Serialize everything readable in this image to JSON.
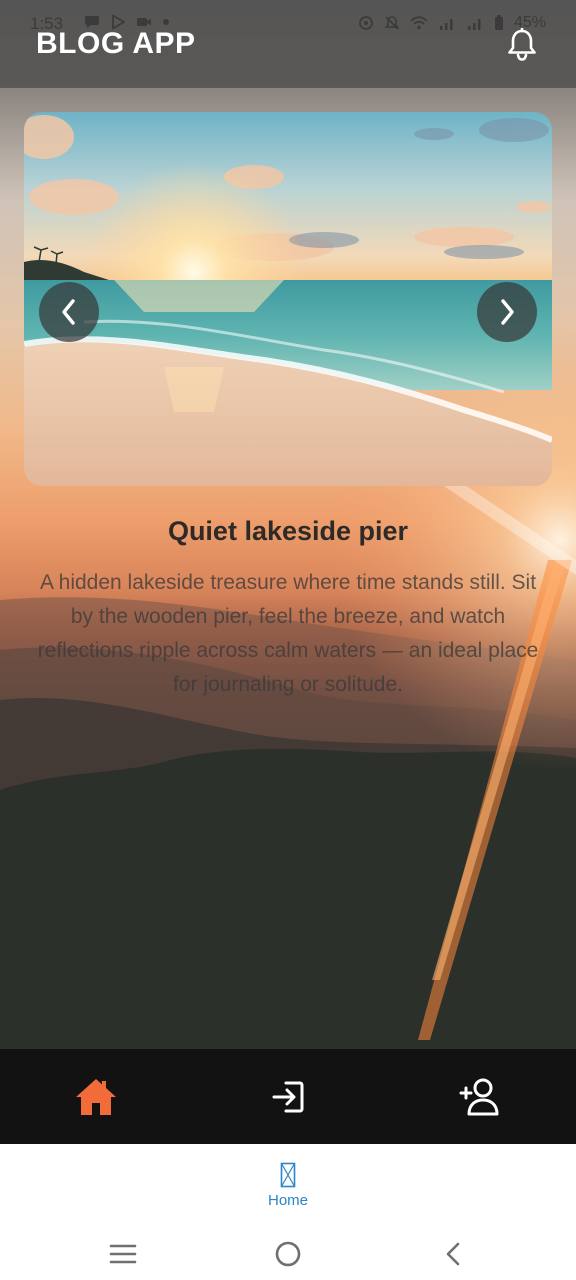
{
  "status_bar": {
    "time": "1:53",
    "battery_text": "45%"
  },
  "header": {
    "title": "BLOG APP",
    "bell_icon": "bell-icon"
  },
  "carousel": {
    "prev_icon": "chevron-left-icon",
    "next_icon": "chevron-right-icon"
  },
  "post": {
    "title": "Quiet lakeside pier",
    "body": "A hidden lakeside treasure where time stands still. Sit by the wooden pier, feel the breeze, and watch reflections ripple across calm waters — an ideal place for journaling or solitude."
  },
  "app_nav": {
    "items": [
      {
        "name": "home",
        "icon": "home-icon",
        "active": true
      },
      {
        "name": "login",
        "icon": "login-icon",
        "active": false
      },
      {
        "name": "signup",
        "icon": "add-user-icon",
        "active": false
      }
    ],
    "active_color": "#f26b3a",
    "inactive_color": "#ffffff"
  },
  "tab_bar": {
    "home_label": "Home",
    "home_color": "#2a86c9"
  },
  "system_nav": {
    "recents_icon": "recents-icon",
    "home_icon": "circle-home-icon",
    "back_icon": "back-icon"
  }
}
